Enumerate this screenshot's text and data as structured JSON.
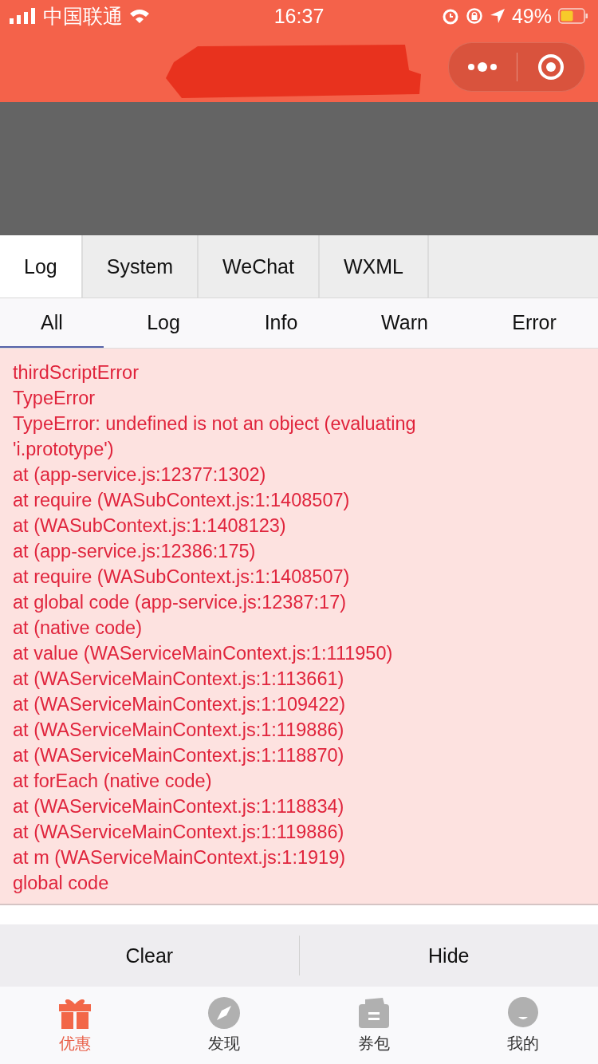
{
  "status_bar": {
    "carrier": "中国联通",
    "time": "16:37",
    "battery": "49%"
  },
  "console": {
    "tabs": [
      {
        "label": "Log",
        "selected": true
      },
      {
        "label": "System",
        "selected": false
      },
      {
        "label": "WeChat",
        "selected": false
      },
      {
        "label": "WXML",
        "selected": false
      }
    ],
    "filters": [
      {
        "label": "All",
        "selected": true
      },
      {
        "label": "Log",
        "selected": false
      },
      {
        "label": "Info",
        "selected": false
      },
      {
        "label": "Warn",
        "selected": false
      },
      {
        "label": "Error",
        "selected": false
      }
    ],
    "error_lines": [
      "thirdScriptError",
      "TypeError",
      "TypeError: undefined is not an object (evaluating",
      "'i.prototype')",
      "at (app-service.js:12377:1302)",
      "at require (WASubContext.js:1:1408507)",
      "at (WASubContext.js:1:1408123)",
      "at (app-service.js:12386:175)",
      "at require (WASubContext.js:1:1408507)",
      "at global code (app-service.js:12387:17)",
      "at (native code)",
      "at value (WAServiceMainContext.js:1:111950)",
      "at (WAServiceMainContext.js:1:113661)",
      "at (WAServiceMainContext.js:1:109422)",
      "at (WAServiceMainContext.js:1:119886)",
      "at (WAServiceMainContext.js:1:118870)",
      "at forEach (native code)",
      "at (WAServiceMainContext.js:1:118834)",
      "at (WAServiceMainContext.js:1:119886)",
      "at m (WAServiceMainContext.js:1:1919)",
      "global code"
    ],
    "actions": [
      "Clear",
      "Hide"
    ]
  },
  "tab_bar": [
    {
      "label": "优惠",
      "kind": "gift",
      "selected": true
    },
    {
      "label": "发现",
      "kind": "compass",
      "selected": false
    },
    {
      "label": "券包",
      "kind": "wallet",
      "selected": false
    },
    {
      "label": "我的",
      "kind": "user",
      "selected": false
    }
  ]
}
